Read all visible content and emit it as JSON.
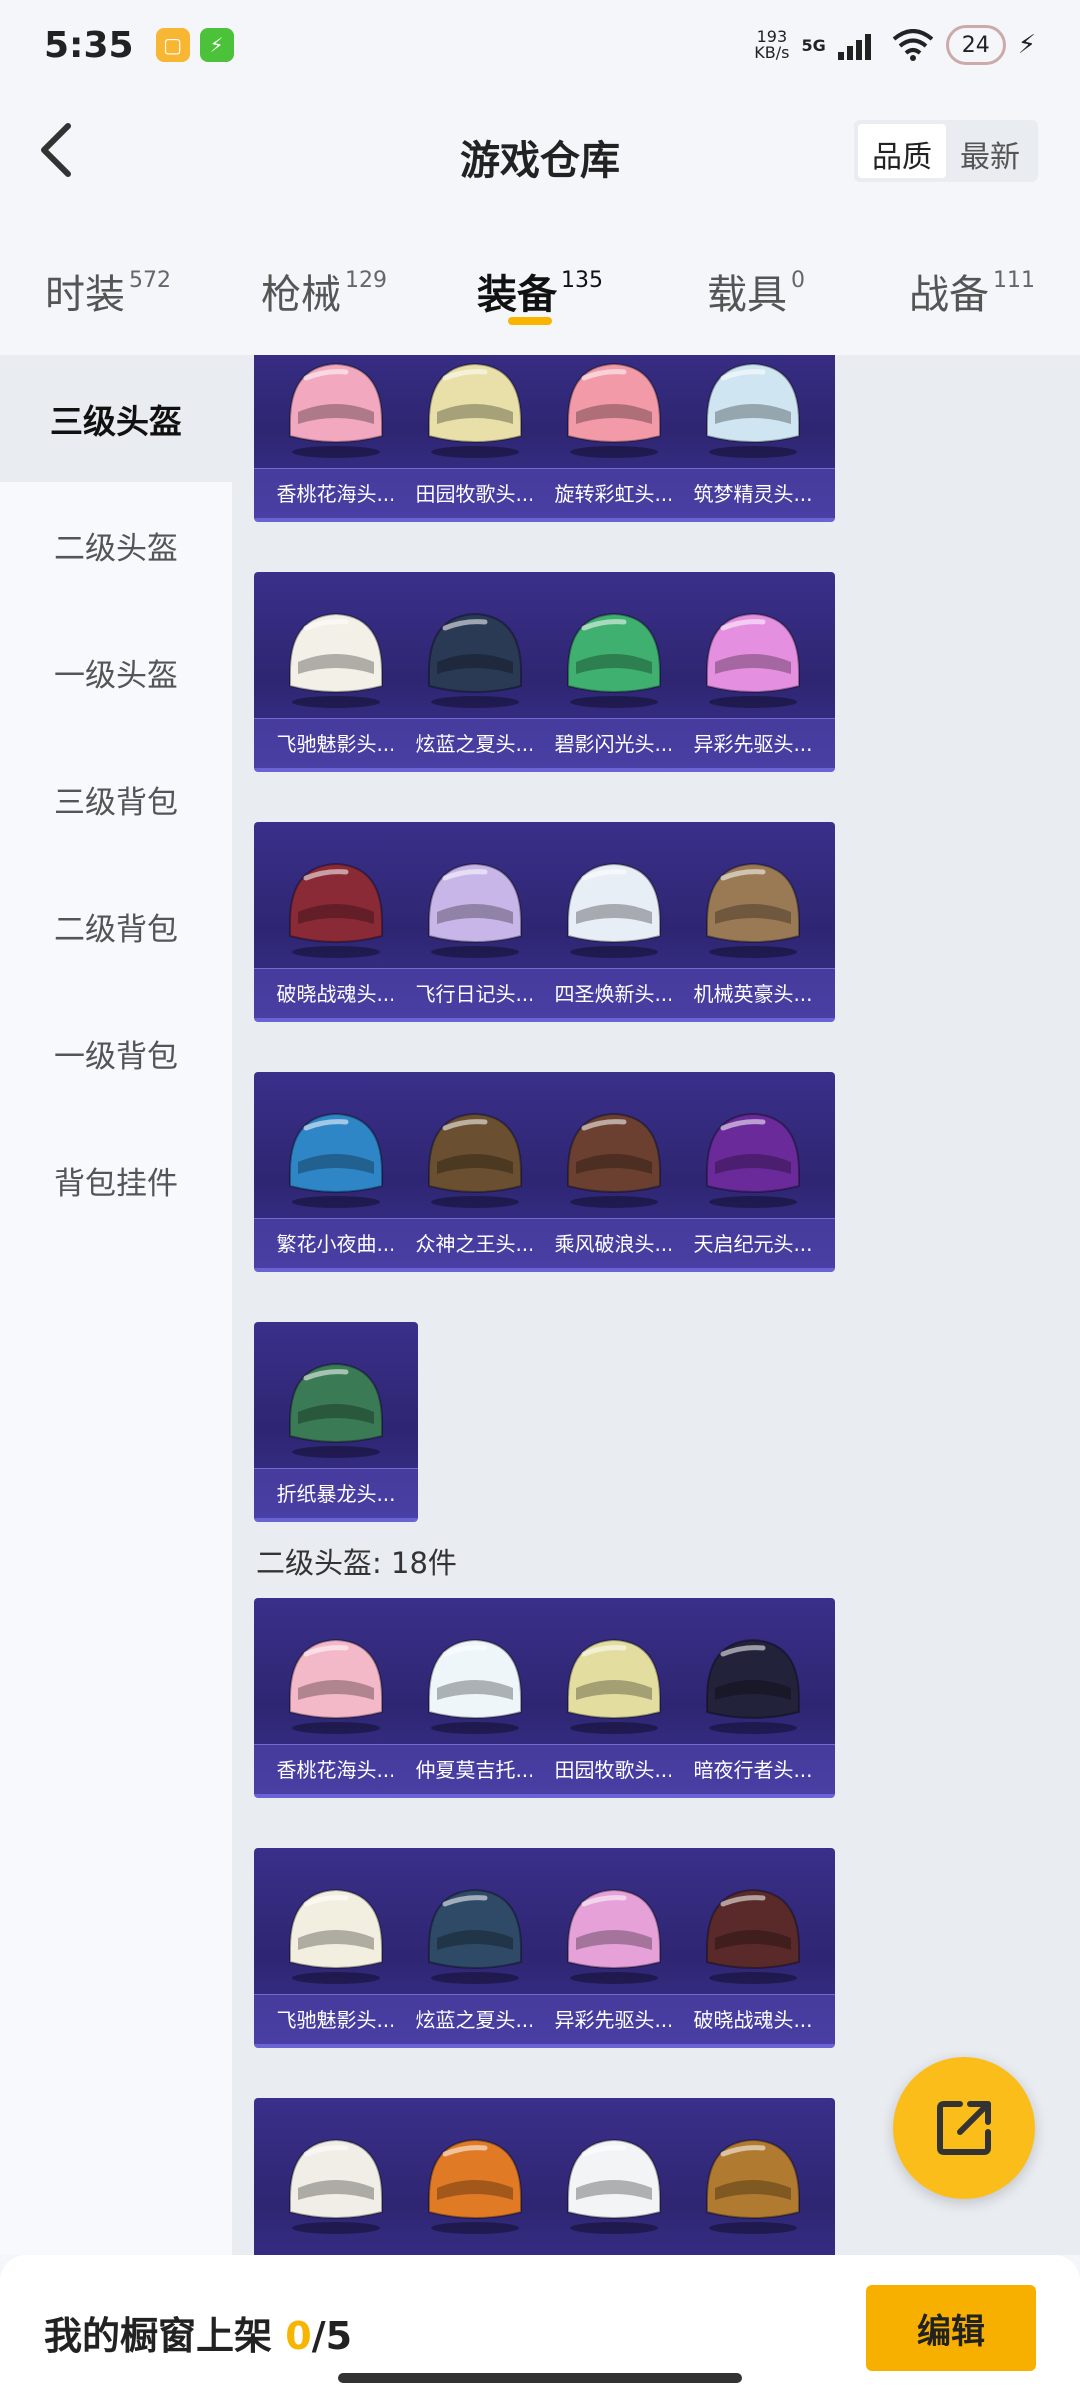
{
  "status_bar": {
    "time": "5:35",
    "net_speed_value": "193",
    "net_speed_unit": "KB/s",
    "network": "5G",
    "battery": "24",
    "icons": [
      "notes-app-icon",
      "charging-app-icon",
      "signal-icon",
      "wifi-icon",
      "charging-bolt-icon"
    ]
  },
  "header": {
    "title": "游戏仓库",
    "sort_options": [
      "品质",
      "最新"
    ],
    "sort_selected": "品质"
  },
  "tabs": [
    {
      "label": "时装",
      "count": "572"
    },
    {
      "label": "枪械",
      "count": "129"
    },
    {
      "label": "装备",
      "count": "135",
      "active": true
    },
    {
      "label": "载具",
      "count": "0"
    },
    {
      "label": "战备",
      "count": "111"
    }
  ],
  "sidebar": [
    {
      "label": "三级头盔",
      "active": true
    },
    {
      "label": "二级头盔"
    },
    {
      "label": "一级头盔"
    },
    {
      "label": "三级背包"
    },
    {
      "label": "二级背包"
    },
    {
      "label": "一级背包"
    },
    {
      "label": "背包挂件"
    }
  ],
  "level3_items": [
    {
      "name": "香桃花海头...",
      "color": "#f2a9c0"
    },
    {
      "name": "田园牧歌头...",
      "color": "#e8e0a8"
    },
    {
      "name": "旋转彩虹头...",
      "color": "#f29aa8"
    },
    {
      "name": "筑梦精灵头...",
      "color": "#cfe6f2"
    },
    {
      "name": "飞驰魅影头...",
      "color": "#f3f0e8"
    },
    {
      "name": "炫蓝之夏头...",
      "color": "#2a3a55"
    },
    {
      "name": "碧影闪光头...",
      "color": "#3fb070"
    },
    {
      "name": "异彩先驱头...",
      "color": "#e58fe0"
    },
    {
      "name": "破晓战魂头...",
      "color": "#8a2a36"
    },
    {
      "name": "飞行日记头...",
      "color": "#c8b6e8"
    },
    {
      "name": "四圣焕新头...",
      "color": "#e8eef5"
    },
    {
      "name": "机械英豪头...",
      "color": "#9a7a55"
    },
    {
      "name": "繁花小夜曲...",
      "color": "#2f86c6"
    },
    {
      "name": "众神之王头...",
      "color": "#6a5030"
    },
    {
      "name": "乘风破浪头...",
      "color": "#6b4030"
    },
    {
      "name": "天启纪元头...",
      "color": "#6a2a9a"
    },
    {
      "name": "折纸暴龙头...",
      "color": "#3a7a55"
    }
  ],
  "level2_section_label": "二级头盔: 18件",
  "level2_items": [
    {
      "name": "香桃花海头...",
      "color": "#f4b9c8"
    },
    {
      "name": "仲夏莫吉托...",
      "color": "#eef6fa"
    },
    {
      "name": "田园牧歌头...",
      "color": "#e3dea0"
    },
    {
      "name": "暗夜行者头...",
      "color": "#22223a"
    },
    {
      "name": "飞驰魅影头...",
      "color": "#f3efe0"
    },
    {
      "name": "炫蓝之夏头...",
      "color": "#2f4a66"
    },
    {
      "name": "异彩先驱头...",
      "color": "#e5a1d8"
    },
    {
      "name": "破晓战魂头...",
      "color": "#5a2a2a"
    },
    {
      "name": "",
      "color": "#f0eee6"
    },
    {
      "name": "",
      "color": "#e07a25"
    },
    {
      "name": "",
      "color": "#f2f4f6"
    },
    {
      "name": "",
      "color": "#b07a30"
    }
  ],
  "bottom_bar": {
    "shelf_label": "我的橱窗上架",
    "shelf_current": "0",
    "shelf_total": "/5",
    "edit_label": "编辑"
  }
}
